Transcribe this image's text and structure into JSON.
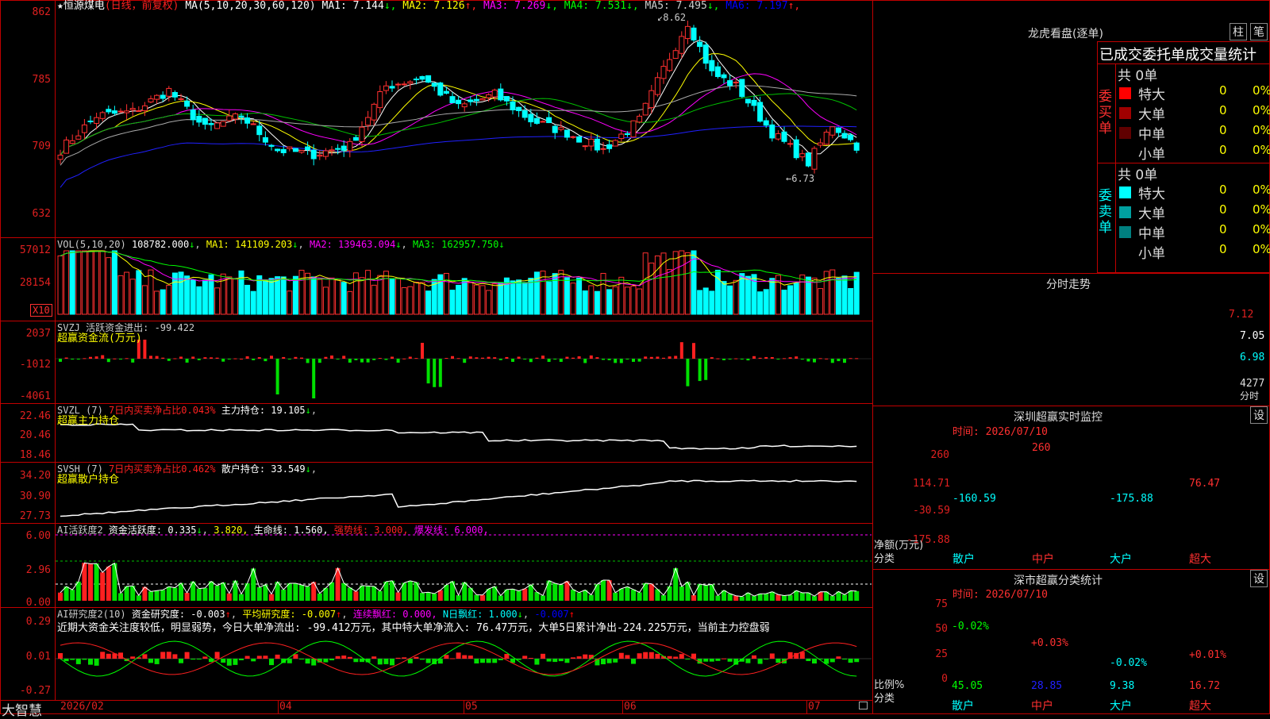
{
  "header": {
    "stock_name": "恒源煤电",
    "period": "(日线，前复权)",
    "ma_label": "MA(5,10,20,30,60,120)",
    "ma": [
      {
        "text": "MA1: 7.144",
        "arrow": "↓",
        "color": "#ffffff"
      },
      {
        "text": "MA2: 7.126",
        "arrow": "↑",
        "color": "#ffff00"
      },
      {
        "text": "MA3: 7.269",
        "arrow": "↓",
        "color": "#ff00ff"
      },
      {
        "text": "MA4: 7.531",
        "arrow": "↓",
        "color": "#00ff00"
      },
      {
        "text": "MA5: 7.495",
        "arrow": "↓",
        "color": "#cccccc"
      },
      {
        "text": "MA6: 7.197",
        "arrow": "↑",
        "color": "#0000ff"
      }
    ],
    "high_mark": "8.62",
    "low_mark": "6.73"
  },
  "price_axis": [
    "862",
    "785",
    "709",
    "632"
  ],
  "vol": {
    "label": "VOL(5,10,20)",
    "value": "108782.000",
    "ma1": "MA1: 141109.203",
    "ma2": "MA2: 139463.094",
    "ma3": "MA3: 162957.750",
    "axis": [
      "57012",
      "28154"
    ],
    "unit": "X10"
  },
  "svzj": {
    "label": "SVZJ  活跃资金进出: -99.422",
    "sub": "超赢资金流(万元)",
    "axis": [
      "2037",
      "-1012",
      "-4061"
    ]
  },
  "svzl": {
    "label": "SVZL (7)",
    "pct": "7日内买卖净占比0.043%",
    "hold": "主力持仓: 19.105",
    "sub": "超赢主力持仓",
    "axis": [
      "22.46",
      "20.46",
      "18.46"
    ]
  },
  "svsh": {
    "label": "SVSH (7)",
    "pct": "7日内买卖净占比0.462%",
    "hold": "散户持仓: 33.549",
    "sub": "超赢散户持仓",
    "axis": [
      "34.20",
      "30.90",
      "27.73"
    ]
  },
  "ai1": {
    "label": "AI活跃度2",
    "v1": "资金活跃度: 0.335",
    "v2": "3.820,",
    "v3": "生命线: 1.560,",
    "v4": "强势线: 3.000,",
    "v5": "爆发线: 6.000,",
    "axis": [
      "6.00",
      "2.96",
      "0.00"
    ]
  },
  "ai2": {
    "label": "AI研究度2(10)",
    "v1": "资金研究度: -0.003",
    "v2": "平均研究度: -0.007",
    "v3": "连续飘红: 0.000,",
    "v4": "N日飘红: 1.000",
    "v5": "-0.007",
    "note": "近期大资金关注度较低，明显弱势，今日大单净流出: -99.412万元，其中特大单净流入: 76.47万元，大单5日累计净出-224.225万元，当前主力控盘弱",
    "axis": [
      "0.29",
      "0.01",
      "-0.27"
    ]
  },
  "xaxis": {
    "brand": "大智慧",
    "labels": [
      "2026/02",
      "04",
      "05",
      "06",
      "07"
    ]
  },
  "right": {
    "lhb_title": "龙虎看盘(逐单)",
    "btn_zhu": "柱",
    "btn_bi": "笔",
    "order_title": "已成交委托单成交量统计",
    "buy_side": "委买单",
    "sell_side": "委卖单",
    "buy_total": "共 0单",
    "sell_total": "共 0单",
    "buy_rows": [
      {
        "name": "特大",
        "count": "0",
        "pct": "0%",
        "color": "#ff0000"
      },
      {
        "name": "大单",
        "count": "0",
        "pct": "0%",
        "color": "#a00000"
      },
      {
        "name": "中单",
        "count": "0",
        "pct": "0%",
        "color": "#600000"
      },
      {
        "name": "小单",
        "count": "0",
        "pct": "0%",
        "color": "#000000"
      }
    ],
    "sell_rows": [
      {
        "name": "特大",
        "count": "0",
        "pct": "0%",
        "color": "#00ffff"
      },
      {
        "name": "大单",
        "count": "0",
        "pct": "0%",
        "color": "#00a0a0"
      },
      {
        "name": "中单",
        "count": "0",
        "pct": "0%",
        "color": "#008080"
      },
      {
        "name": "小单",
        "count": "0",
        "pct": "0%",
        "color": "#000000"
      }
    ],
    "intraday_title": "分时走势",
    "intraday_axis": [
      "7.12",
      "7.05",
      "6.98"
    ],
    "intraday_vol": "4277",
    "intraday_vol_label": "分时",
    "monitor_title": "深圳超赢实时监控",
    "monitor_btn": "设",
    "monitor_time": "时间: 2026/07/10",
    "monitor_axis": [
      "260",
      "114.71",
      "-30.59",
      "-175.88"
    ],
    "monitor_ylabel": "净额(万元)",
    "monitor_xlabel": "分类",
    "monitor_bars": [
      {
        "name": "散户",
        "value": "-160.59"
      },
      {
        "name": "中户",
        "value": "260"
      },
      {
        "name": "大户",
        "value": "-175.88"
      },
      {
        "name": "超大",
        "value": "76.47"
      }
    ],
    "class_title": "深市超赢分类统计",
    "class_btn": "设",
    "class_time": "时间: 2026/07/10",
    "class_axis": [
      "75",
      "50",
      "25",
      "0"
    ],
    "class_ylabel": "比例%",
    "class_xlabel": "分类",
    "class_bars": [
      {
        "name": "散户",
        "value": "45.05",
        "delta": "-0.02%"
      },
      {
        "name": "中户",
        "value": "28.85",
        "delta": "+0.03%"
      },
      {
        "name": "大户",
        "value": "9.38",
        "delta": "-0.02%"
      },
      {
        "name": "超大",
        "value": "16.72",
        "delta": "+0.01%"
      }
    ]
  },
  "colors": {
    "up": "#ff3030",
    "down": "#00ffff",
    "frame": "#c00000",
    "label": "#e02020"
  }
}
